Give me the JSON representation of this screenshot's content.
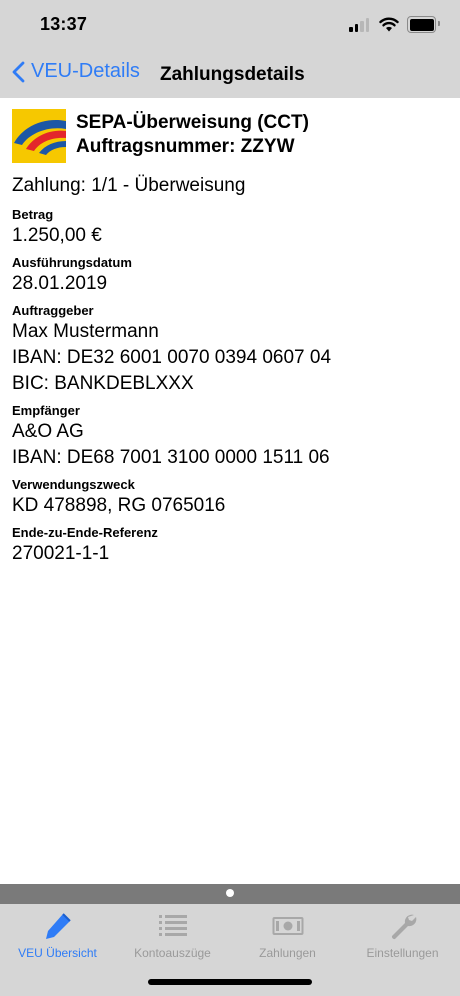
{
  "status_bar": {
    "time": "13:37"
  },
  "nav": {
    "back_label": "VEU-Details",
    "title": "Zahlungsdetails"
  },
  "header": {
    "title": "SEPA-Überweisung (CCT)",
    "order": "Auftragsnummer: ZZYW"
  },
  "payment": {
    "summary": "Zahlung: 1/1 - Überweisung",
    "amount_label": "Betrag",
    "amount": "1.250,00 €",
    "date_label": "Ausführungsdatum",
    "date": "28.01.2019",
    "orderer_label": "Auftraggeber",
    "orderer_name": "Max Mustermann",
    "orderer_iban": "IBAN: DE32 6001 0070 0394 0607 04",
    "orderer_bic": "BIC: BANKDEBLXXX",
    "recipient_label": "Empfänger",
    "recipient_name": "A&O AG",
    "recipient_iban": "IBAN: DE68 7001 3100 0000 1511 06",
    "purpose_label": "Verwendungszweck",
    "purpose": "KD 478898, RG 0765016",
    "e2e_label": "Ende-zu-Ende-Referenz",
    "e2e": "270021-1-1"
  },
  "tabs": [
    {
      "label": "VEU Übersicht",
      "icon": "pen-icon",
      "active": true
    },
    {
      "label": "Kontoauszüge",
      "icon": "list-icon",
      "active": false
    },
    {
      "label": "Zahlungen",
      "icon": "banknote-icon",
      "active": false
    },
    {
      "label": "Einstellungen",
      "icon": "wrench-icon",
      "active": false
    }
  ],
  "colors": {
    "accent": "#2f7cf6",
    "bar_background": "#d6d6d6",
    "logo_yellow": "#f6c800",
    "logo_red": "#e3262b",
    "logo_blue": "#1c57a6"
  }
}
